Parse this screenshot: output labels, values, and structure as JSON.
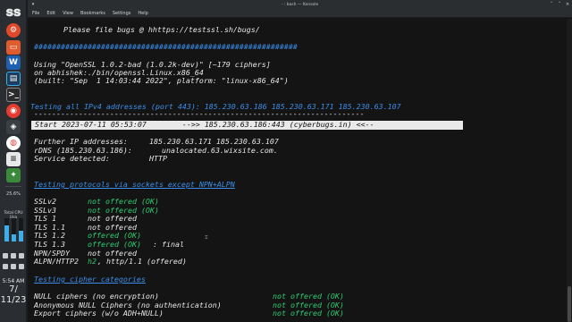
{
  "window": {
    "title": "- : bash — Konsole",
    "menu": [
      "File",
      "Edit",
      "View",
      "Bookmarks",
      "Settings",
      "Help"
    ]
  },
  "dock": {
    "cpu_percent": "25.6%",
    "cpu_label": "Total CPU Usa",
    "clock_time": "5:54 AM",
    "clock_month_day": "7/",
    "clock_date_rest": "11/23"
  },
  "terminal": {
    "bug_line": "Please file bugs @ hhttps://testssl.sh/bugs/",
    "hash_line": "###########################################################",
    "using_1": "Using \"OpenSSL 1.0.2-bad (1.0.2k-dev)\" [~179 ciphers]",
    "using_2": "on abhishek:./bin/openssl.Linux.x86_64",
    "using_3": "(built: \"Sep  1 14:03:44 2022\", platform: \"linux-x86_64\")",
    "testing_all": "Testing all IPv4 addresses (port 443): 185.230.63.186 185.230.63.171 185.230.63.107",
    "dash_line": "--------------------------------------------------------------------------",
    "start_line": "Start 2023-07-11 05:53:07        -->> 185.230.63.186:443 (cyberbugs.in) <<--",
    "further_label": "Further IP addresses:",
    "further_value": "185.230.63.171 185.230.63.107",
    "rdns_label": "rDNS (185.230.63.186):",
    "rdns_value": "unalocated.63.wixsite.com.",
    "service_label": "Service detected:",
    "service_value": "HTTP",
    "proto_heading": "Testing protocols via sockets except NPN+ALPN",
    "protocols": [
      {
        "name": "SSLv2",
        "status": "not offered (OK)",
        "extra": ""
      },
      {
        "name": "SSLv3",
        "status": "not offered (OK)",
        "extra": ""
      },
      {
        "name": "TLS 1",
        "status": "not offered",
        "extra": ""
      },
      {
        "name": "TLS 1.1",
        "status": "not offered",
        "extra": ""
      },
      {
        "name": "TLS 1.2",
        "status": "offered (OK)",
        "extra": ""
      },
      {
        "name": "TLS 1.3",
        "status": "offered (OK)",
        "extra": ": final"
      },
      {
        "name": "NPN/SPDY",
        "status": "not offered",
        "extra": ""
      },
      {
        "name": "ALPN/HTTP2",
        "status": "h2",
        "extra": ", http/1.1 (offered)"
      }
    ],
    "cipher_heading": "Testing cipher categories",
    "ciphers": [
      {
        "name": "NULL ciphers (no encryption)",
        "status": "not offered (OK)"
      },
      {
        "name": "Anonymous NULL Ciphers (no authentication)",
        "status": "not offered (OK)"
      },
      {
        "name": "Export ciphers (w/o ADH+NULL)",
        "status": "not offered (OK)"
      }
    ]
  }
}
